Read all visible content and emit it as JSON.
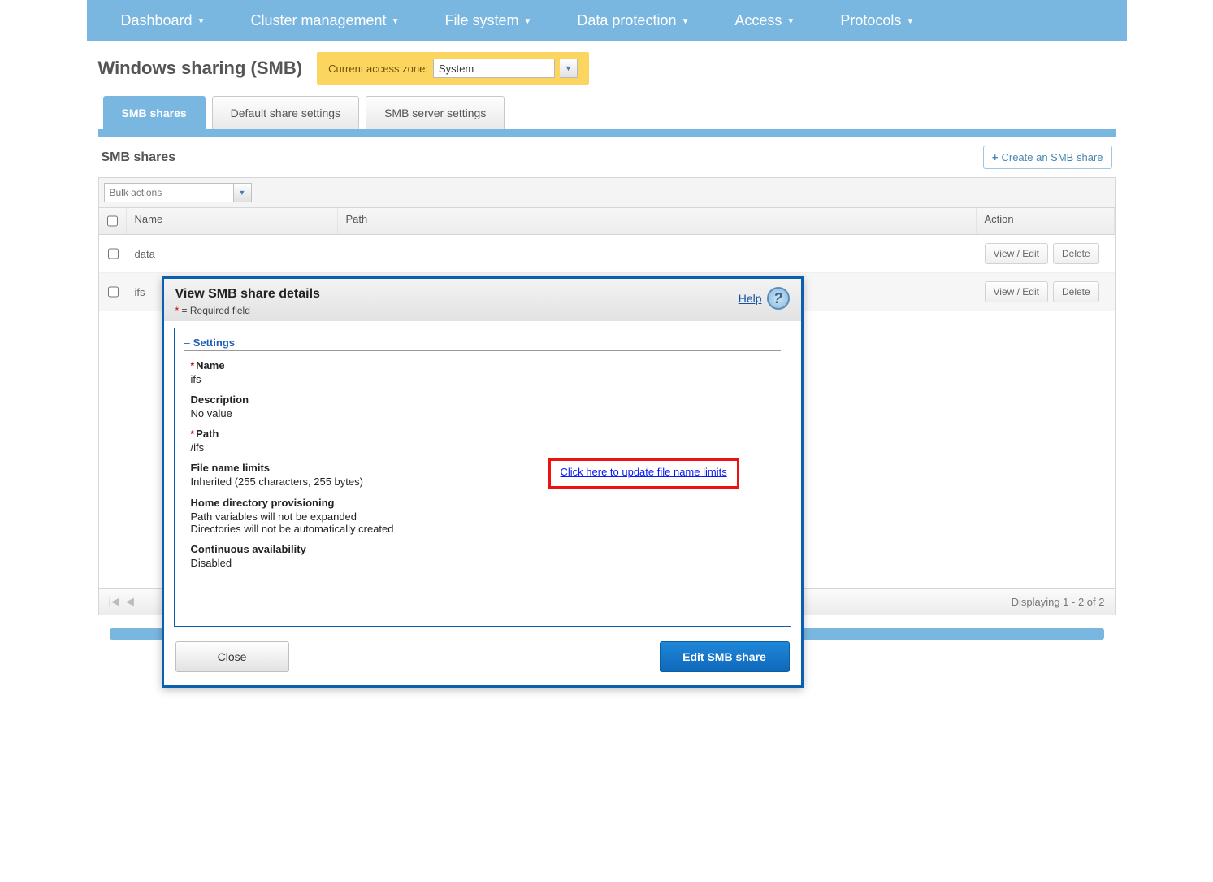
{
  "nav": {
    "items": [
      {
        "label": "Dashboard"
      },
      {
        "label": "Cluster management"
      },
      {
        "label": "File system"
      },
      {
        "label": "Data protection"
      },
      {
        "label": "Access"
      },
      {
        "label": "Protocols"
      }
    ]
  },
  "page": {
    "title": "Windows sharing (SMB)",
    "zone_label": "Current access zone:",
    "zone_value": "System"
  },
  "tabs": [
    {
      "label": "SMB shares",
      "active": true
    },
    {
      "label": "Default share settings",
      "active": false
    },
    {
      "label": "SMB server settings",
      "active": false
    }
  ],
  "panel": {
    "title": "SMB shares",
    "create_label": "Create an SMB share",
    "bulk_placeholder": "Bulk actions",
    "columns": {
      "name": "Name",
      "path": "Path",
      "action": "Action"
    },
    "rows": [
      {
        "name": "data",
        "path": ""
      },
      {
        "name": "ifs",
        "path": ""
      }
    ],
    "action_view": "View / Edit",
    "action_delete": "Delete",
    "footer_text": "Displaying 1 - 2 of 2"
  },
  "modal": {
    "title": "View SMB share details",
    "required_note": " = Required field",
    "help_label": "Help",
    "legend": "Settings",
    "fields": {
      "name_label": "Name",
      "name_value": "ifs",
      "desc_label": "Description",
      "desc_value": "No value",
      "path_label": "Path",
      "path_value": "/ifs",
      "fnl_label": "File name limits",
      "fnl_value": "Inherited (255 characters, 255 bytes)",
      "fnl_link": "Click here to update file name limits",
      "hdp_label": "Home directory provisioning",
      "hdp_value1": "Path variables will not be expanded",
      "hdp_value2": "Directories will not be automatically created",
      "ca_label": "Continuous availability",
      "ca_value": "Disabled"
    },
    "close_label": "Close",
    "edit_label": "Edit SMB share"
  }
}
